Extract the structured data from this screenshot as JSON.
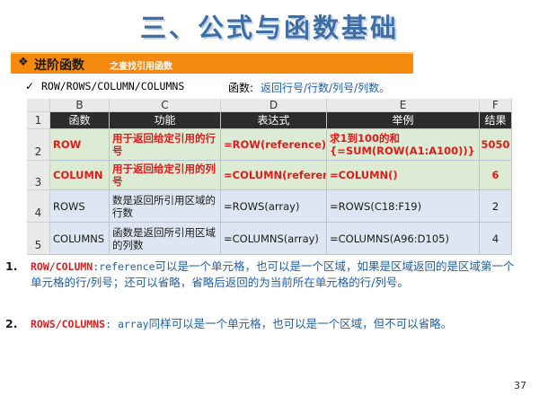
{
  "slide_title": "三、公式与函数基础",
  "banner": {
    "bullet": "❖",
    "main": "进阶函数",
    "sub": "之查找引用函数"
  },
  "intro": {
    "check": "✓",
    "code": "ROW/ROWS/COLUMN/COLUMNS",
    "label": "函数:",
    "desc": "返回行号/行数/列号/列数。"
  },
  "sheet": {
    "col_headers": [
      "B",
      "C",
      "D",
      "E",
      "F"
    ],
    "row_headers": [
      "1",
      "2",
      "3",
      "4",
      "5"
    ],
    "header_row": [
      "函数",
      "功能",
      "表达式",
      "举例",
      "结果"
    ],
    "rows": [
      [
        "ROW",
        "用于返回给定引用的行号",
        "=ROW(reference)",
        "求1到100的和 {=SUM(ROW(A1:A100))}",
        "5050"
      ],
      [
        "COLUMN",
        "用于返回给定引用的列号",
        "=COLUMN(reference)",
        "=COLUMN()",
        "6"
      ],
      [
        "ROWS",
        "数是返回所引用区域的行数",
        "=ROWS(array)",
        "=ROWS(C18:F19)",
        "2"
      ],
      [
        "COLUMNS",
        "函数是返回所引用区域的列数",
        "=COLUMNS(array)",
        "=COLUMNS(A96:D105)",
        "4"
      ]
    ]
  },
  "notes": [
    {
      "num": "1.",
      "keyword": "ROW/COLUMN",
      "sep": ":",
      "term": "reference",
      "text": "可以是一个单元格，也可以是一个区域，如果是区域返回的是区域第一个单元格的行/列号；还可以省略，省略后返回的为当前所在单元格的行/列号。"
    },
    {
      "num": "2.",
      "keyword": "ROWS/COLUMNS",
      "sep": ": ",
      "term": "array",
      "text": "同样可以是一个单元格，也可以是一个区域，但不可以省略。"
    }
  ],
  "page_number": "37",
  "colors": {
    "title": "#3e6ea6",
    "banner": "#f58a0e",
    "accent_red": "#e01b1b",
    "text_blue": "#1f5fa8",
    "header_bg": "#2c2c2c",
    "row_green": "#dcebd3",
    "row_blue": "#dde6f2"
  }
}
